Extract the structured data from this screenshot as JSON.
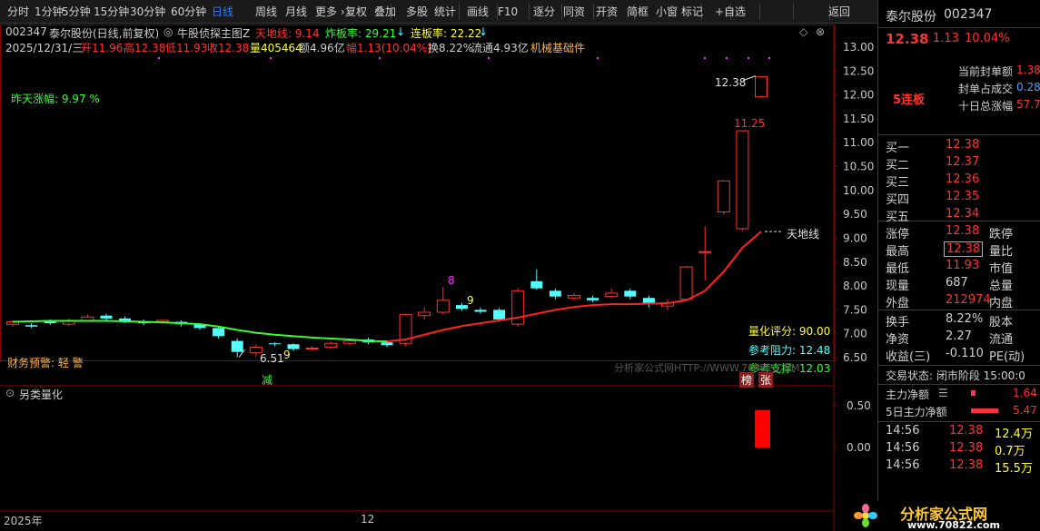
{
  "toolbar": {
    "items": [
      "分时",
      "1分钟",
      "5分钟",
      "15分钟",
      "30分钟",
      "60分钟",
      "日线",
      "周线",
      "月线",
      "更多 ›",
      "复权",
      "叠加",
      "多股",
      "统计",
      "画线",
      "F10",
      "逐分",
      "同资",
      "开资",
      "简框",
      "小窗",
      "标记",
      "+自选",
      "返回"
    ],
    "active": "日线"
  },
  "header": {
    "code": "002347",
    "name": "泰尔股份(日线,前复权)",
    "indicator": "牛股侦探主图Z",
    "tdx_label": "天地线: 9.14",
    "zbl_label": "炸板率: 29.21",
    "lbl_label": "连板率: 22.22",
    "date": "2025/12/31/三",
    "open": "开11.96",
    "high": "高12.38",
    "low": "低11.93",
    "close": "收12.38",
    "vol": "量405464",
    "amount": "额4.96亿",
    "change": "幅1.13(10.04%)",
    "turnover": "换8.22%",
    "float": "流通4.93亿",
    "concept": "机械基础件"
  },
  "annotations": {
    "yesterday": "昨天涨幅: 9.97 %",
    "price_top": "12.38",
    "price_high": "11.25",
    "tiandi": "天地线",
    "low_label": "6.51",
    "n8": "8",
    "n9a": "9",
    "n9b": "9",
    "quant_score": "量化评分: 90.00",
    "ref_resist": "参考阻力: 12.48",
    "ref_support": "参考支撑: 12.03",
    "finance": "财务预警: 轻  警",
    "jian": "减",
    "bang": "榜",
    "zhang": "张",
    "watermark": "分析家公式网HTTP://WWW.70822.COM",
    "sub_title": "另类量化"
  },
  "axis": {
    "price_ticks": [
      "13.00",
      "12.50",
      "12.00",
      "11.50",
      "11.00",
      "10.50",
      "10.00",
      "9.50",
      "9.00",
      "8.50",
      "8.00",
      "7.50",
      "7.00",
      "6.50"
    ],
    "sub_ticks": [
      "0.50",
      "0.00"
    ],
    "x_labels": [
      "2025年",
      "12"
    ]
  },
  "chart_data": {
    "type": "candlestick",
    "title": "泰尔股份(日线,前复权)",
    "ylim": [
      6.3,
      13.2
    ],
    "candles": [
      {
        "o": 7.2,
        "c": 7.25,
        "h": 7.28,
        "l": 7.15
      },
      {
        "o": 7.18,
        "c": 7.15,
        "h": 7.22,
        "l": 7.12
      },
      {
        "o": 7.25,
        "c": 7.22,
        "h": 7.3,
        "l": 7.18
      },
      {
        "o": 7.2,
        "c": 7.28,
        "h": 7.32,
        "l": 7.16
      },
      {
        "o": 7.28,
        "c": 7.35,
        "h": 7.4,
        "l": 7.25
      },
      {
        "o": 7.38,
        "c": 7.32,
        "h": 7.42,
        "l": 7.28
      },
      {
        "o": 7.32,
        "c": 7.25,
        "h": 7.36,
        "l": 7.22
      },
      {
        "o": 7.25,
        "c": 7.22,
        "h": 7.3,
        "l": 7.18
      },
      {
        "o": 7.25,
        "c": 7.28,
        "h": 7.3,
        "l": 7.2
      },
      {
        "o": 7.25,
        "c": 7.2,
        "h": 7.28,
        "l": 7.15
      },
      {
        "o": 7.2,
        "c": 7.12,
        "h": 7.22,
        "l": 7.08
      },
      {
        "o": 7.12,
        "c": 6.95,
        "h": 7.15,
        "l": 6.9
      },
      {
        "o": 6.85,
        "c": 6.62,
        "h": 6.9,
        "l": 6.51
      },
      {
        "o": 6.6,
        "c": 6.72,
        "h": 6.78,
        "l": 6.52
      },
      {
        "o": 6.8,
        "c": 6.78,
        "h": 6.82,
        "l": 6.74
      },
      {
        "o": 6.78,
        "c": 6.68,
        "h": 6.8,
        "l": 6.64
      },
      {
        "o": 6.7,
        "c": 6.7,
        "h": 6.74,
        "l": 6.66
      },
      {
        "o": 6.72,
        "c": 6.8,
        "h": 6.84,
        "l": 6.68
      },
      {
        "o": 6.8,
        "c": 6.85,
        "h": 6.88,
        "l": 6.76
      },
      {
        "o": 6.88,
        "c": 6.82,
        "h": 6.92,
        "l": 6.78
      },
      {
        "o": 6.82,
        "c": 6.76,
        "h": 6.84,
        "l": 6.72
      },
      {
        "o": 6.8,
        "c": 7.4,
        "h": 7.42,
        "l": 6.74
      },
      {
        "o": 7.38,
        "c": 7.45,
        "h": 7.55,
        "l": 7.3
      },
      {
        "o": 7.45,
        "c": 7.7,
        "h": 7.98,
        "l": 7.4
      },
      {
        "o": 7.6,
        "c": 7.52,
        "h": 7.65,
        "l": 7.48
      },
      {
        "o": 7.5,
        "c": 7.46,
        "h": 7.55,
        "l": 7.42
      },
      {
        "o": 7.5,
        "c": 7.3,
        "h": 7.54,
        "l": 7.25
      },
      {
        "o": 7.2,
        "c": 7.9,
        "h": 7.95,
        "l": 7.15
      },
      {
        "o": 8.1,
        "c": 7.95,
        "h": 8.35,
        "l": 7.92
      },
      {
        "o": 7.9,
        "c": 7.78,
        "h": 7.95,
        "l": 7.72
      },
      {
        "o": 7.75,
        "c": 7.8,
        "h": 7.85,
        "l": 7.7
      },
      {
        "o": 7.75,
        "c": 7.7,
        "h": 7.8,
        "l": 7.66
      },
      {
        "o": 7.78,
        "c": 7.85,
        "h": 7.95,
        "l": 7.74
      },
      {
        "o": 7.9,
        "c": 7.78,
        "h": 7.95,
        "l": 7.72
      },
      {
        "o": 7.75,
        "c": 7.62,
        "h": 7.8,
        "l": 7.55
      },
      {
        "o": 7.58,
        "c": 7.65,
        "h": 7.72,
        "l": 7.5
      },
      {
        "o": 7.72,
        "c": 8.4,
        "h": 8.42,
        "l": 7.68
      },
      {
        "o": 8.7,
        "c": 8.72,
        "h": 9.25,
        "l": 8.12
      },
      {
        "o": 9.55,
        "c": 10.2,
        "h": 10.22,
        "l": 9.5
      },
      {
        "o": 9.2,
        "c": 11.25,
        "h": 11.25,
        "l": 9.15
      },
      {
        "o": 11.96,
        "c": 12.38,
        "h": 12.38,
        "l": 11.93
      }
    ],
    "ma_green": [
      7.25,
      7.26,
      7.27,
      7.27,
      7.27,
      7.27,
      7.26,
      7.25,
      7.24,
      7.22,
      7.2,
      7.15,
      7.08,
      7.02,
      6.98,
      6.95,
      6.92,
      6.9,
      6.88,
      6.85,
      6.84
    ],
    "ma_red": [
      6.84,
      6.88,
      6.98,
      7.08,
      7.16,
      7.22,
      7.28,
      7.34,
      7.42,
      7.5,
      7.56,
      7.6,
      7.62,
      7.62,
      7.63,
      7.64,
      7.7,
      7.9,
      8.3,
      8.8,
      9.14
    ],
    "sub_bar": {
      "value": 0.45,
      "index": 40
    }
  },
  "right": {
    "name": "泰尔股份",
    "code": "002347",
    "price": "12.38",
    "chg": "1.13",
    "pct": "10.04%",
    "lianban": "5连板",
    "fengdan_label": "当前封单额",
    "fengdan_val": "1.38",
    "fengdan_ratio_label": "封单占成交",
    "fengdan_ratio_val": "0.28",
    "ten_day_label": "十日总涨幅",
    "ten_day_val": "57.7",
    "bids": [
      {
        "label": "买一",
        "price": "12.38"
      },
      {
        "label": "买二",
        "price": "12.37"
      },
      {
        "label": "买三",
        "price": "12.36"
      },
      {
        "label": "买四",
        "price": "12.35"
      },
      {
        "label": "买五",
        "price": "12.34"
      }
    ],
    "stats": [
      {
        "k": "涨停",
        "v": "12.38",
        "k2": "跌停"
      },
      {
        "k": "最高",
        "v": "12.38",
        "k2": "量比"
      },
      {
        "k": "最低",
        "v": "11.93",
        "k2": "市值"
      },
      {
        "k": "现量",
        "v": "687",
        "k2": "总量"
      },
      {
        "k": "外盘",
        "v": "212974",
        "k2": "内盘"
      }
    ],
    "stats2": [
      {
        "k": "换手",
        "v": "8.22%",
        "k2": "股本"
      },
      {
        "k": "净资",
        "v": "2.27",
        "k2": "流通"
      },
      {
        "k": "收益(三)",
        "v": "-0.110",
        "k2": "PE(动)"
      }
    ],
    "status": "交易状态: 闭市阶段 15:00:0",
    "zhuli": "主力净额",
    "zhuli_val": "1.64",
    "zhuli5": "5日主力净额",
    "zhuli5_val": "5.47",
    "ticks": [
      {
        "t": "14:56",
        "p": "12.38",
        "v": "12.4万"
      },
      {
        "t": "14:56",
        "p": "12.38",
        "v": "0.7万"
      },
      {
        "t": "14:56",
        "p": "12.38",
        "v": "15.5万"
      }
    ]
  },
  "logo": {
    "name": "分析家公式网",
    "url": "www.70822.com"
  },
  "colors": {
    "red": "#ff3333",
    "cyan": "#54ffff",
    "green": "#33ff33",
    "yellow": "#ffff33",
    "blue_active": "#2f7ff7"
  }
}
